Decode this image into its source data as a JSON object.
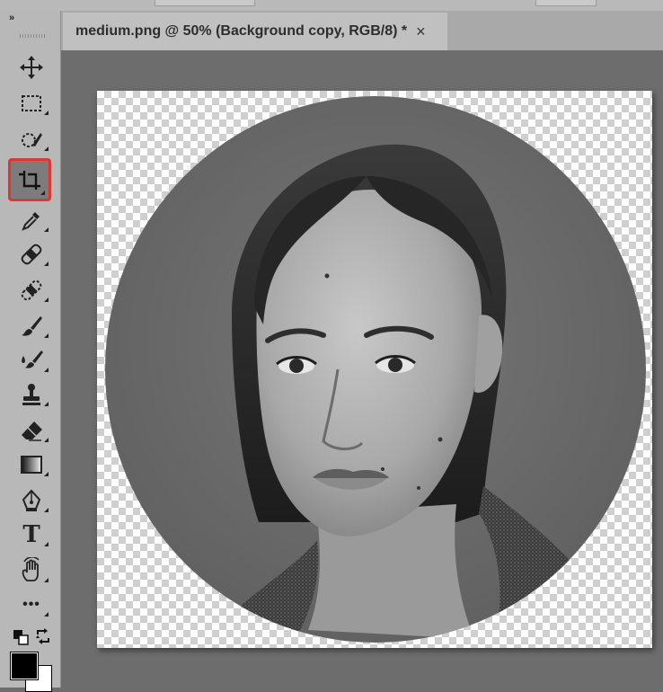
{
  "toolbar": {
    "collapse_glyph": "»",
    "tools": [
      {
        "name": "move-tool",
        "icon": "move-icon"
      },
      {
        "name": "marquee-tool",
        "icon": "rectangular-marquee-icon"
      },
      {
        "name": "quick-selection-tool",
        "icon": "quick-selection-icon"
      },
      {
        "name": "crop-tool",
        "icon": "crop-icon",
        "active": true
      },
      {
        "name": "eyedropper-tool",
        "icon": "eyedropper-icon"
      },
      {
        "name": "spot-healing-tool",
        "icon": "bandage-icon"
      },
      {
        "name": "healing-brush-tool",
        "icon": "patch-icon"
      },
      {
        "name": "brush-tool",
        "icon": "brush-icon"
      },
      {
        "name": "mixer-brush-tool",
        "icon": "mixer-brush-icon"
      },
      {
        "name": "clone-stamp-tool",
        "icon": "stamp-icon"
      },
      {
        "name": "eraser-tool",
        "icon": "eraser-icon"
      },
      {
        "name": "gradient-tool",
        "icon": "gradient-icon"
      },
      {
        "name": "pen-tool",
        "icon": "pen-icon"
      },
      {
        "name": "type-tool",
        "icon": "type-icon",
        "label": "T"
      },
      {
        "name": "hand-tool",
        "icon": "hand-icon"
      },
      {
        "name": "more-tools",
        "icon": "ellipsis-icon",
        "label": "•••"
      }
    ],
    "foreground_color": "#000000",
    "background_color": "#ffffff"
  },
  "document": {
    "tab_title": "medium.png @ 50% (Background copy, RGB/8) *",
    "close_glyph": "×"
  },
  "colors": {
    "active_highlight": "#e2352f",
    "workspace_bg": "#6d6d6d",
    "toolbar_bg": "#b8b8b8"
  }
}
